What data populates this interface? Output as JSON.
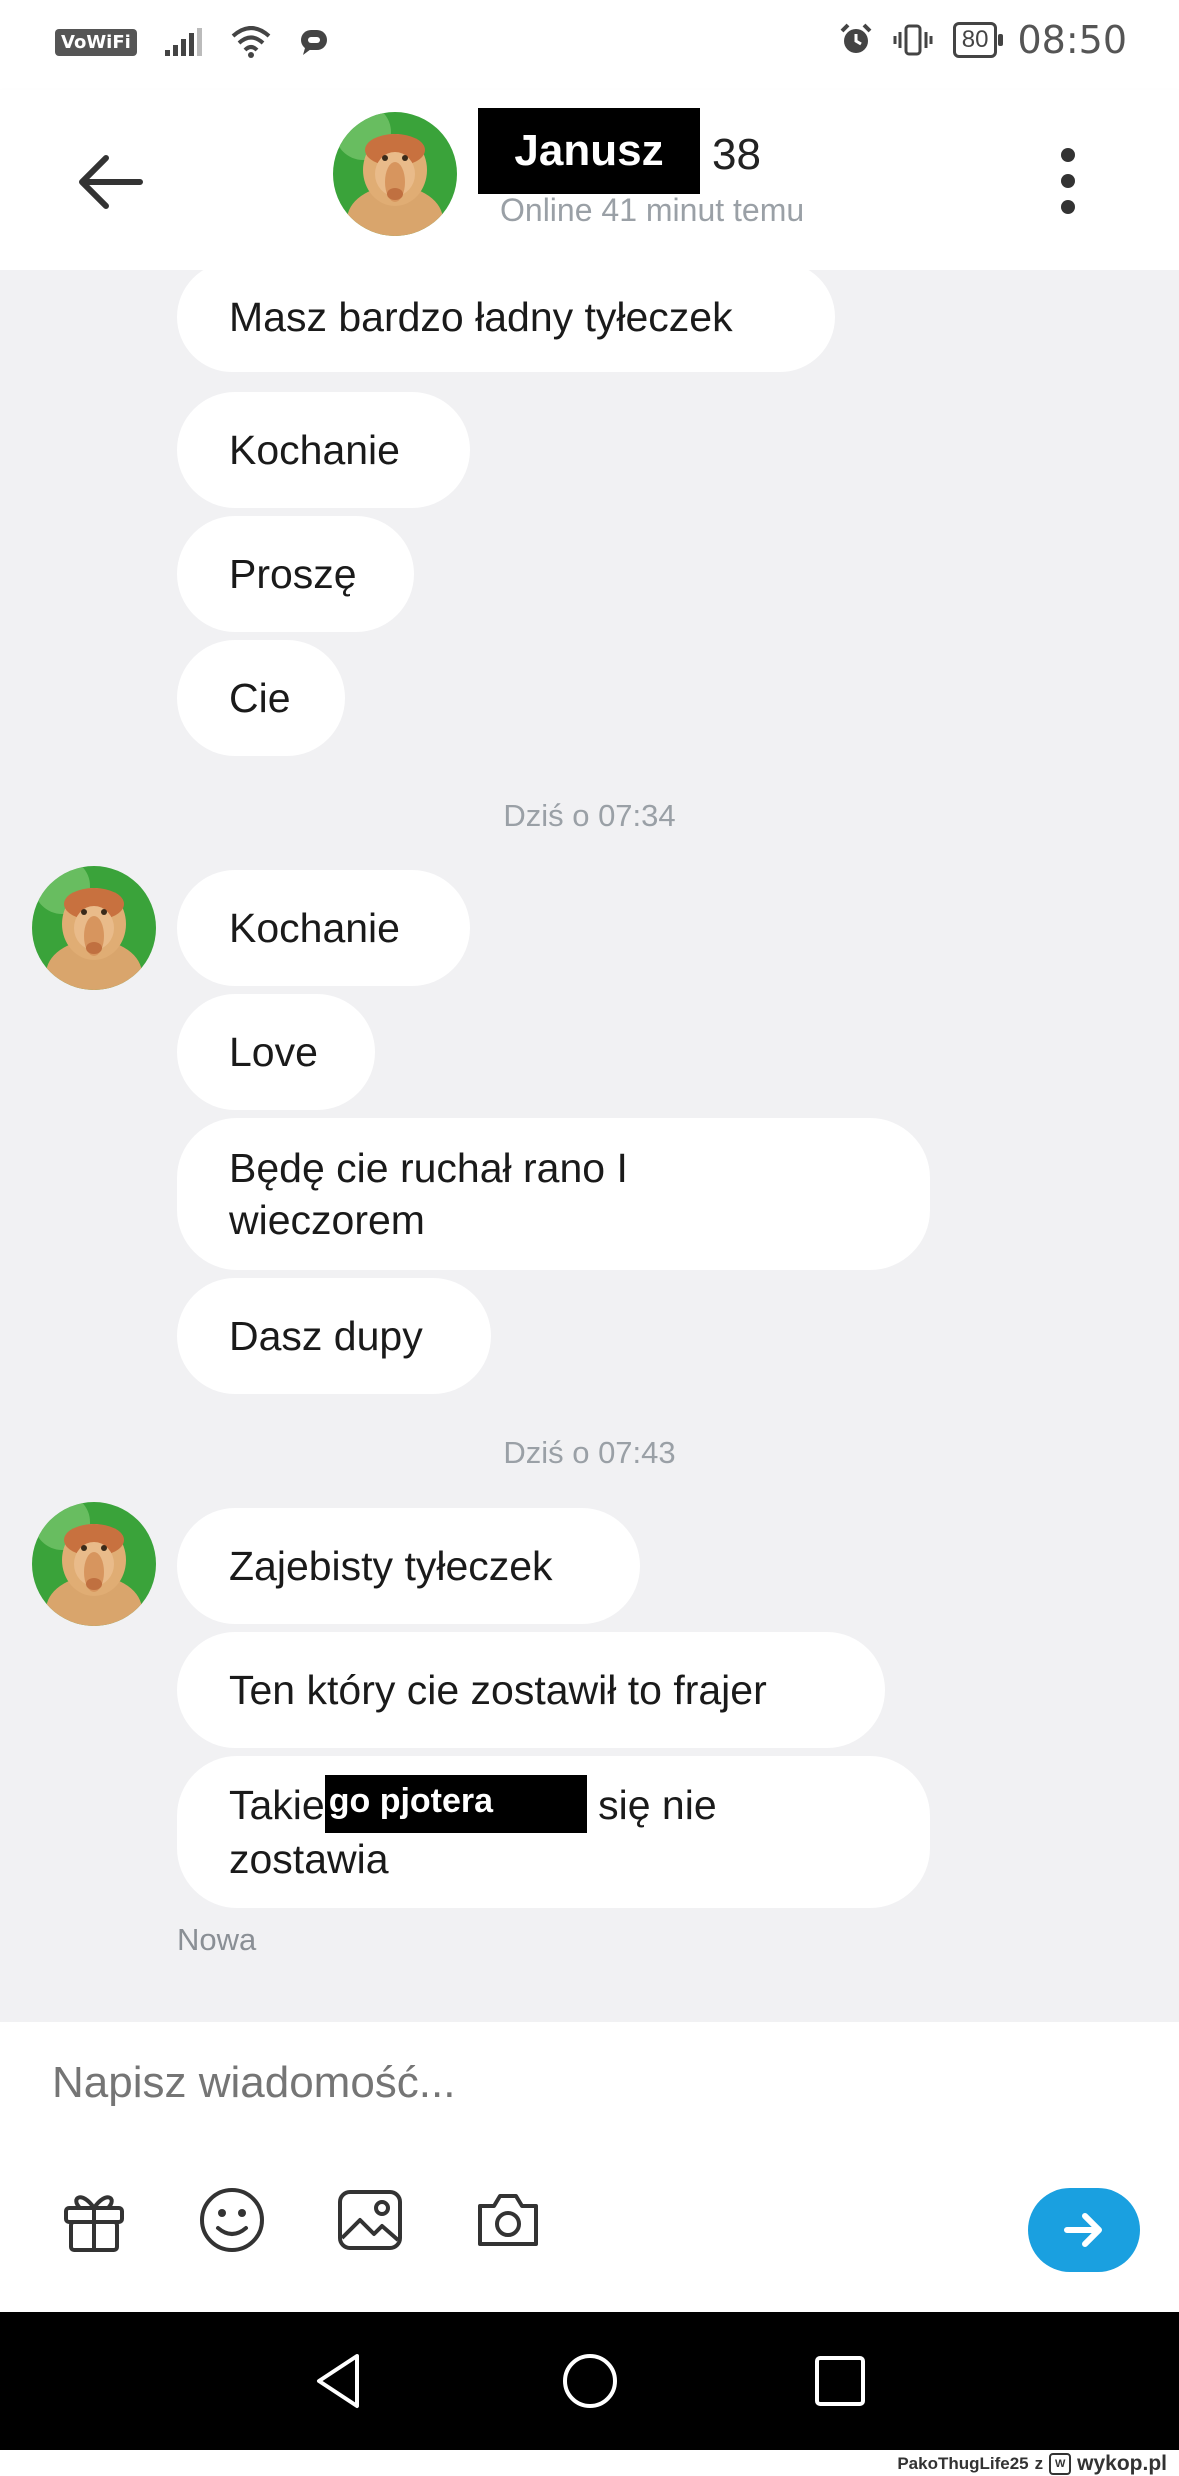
{
  "status_bar": {
    "vowifi": "VoWiFi",
    "battery": "80",
    "time": "08:50"
  },
  "header": {
    "name": "Janusz",
    "age": "38",
    "status": "Online 41 minut temu"
  },
  "messages_top": [
    "Masz bardzo ładny tyłeczek",
    "Kochanie",
    "Proszę",
    "Cie"
  ],
  "group1": {
    "timestamp": "Dziś o 07:34",
    "messages": [
      "Kochanie",
      "Love",
      "Będę cie ruchał rano I wieczorem",
      "Dasz dupy"
    ]
  },
  "group2": {
    "timestamp": "Dziś o 07:43",
    "messages": [
      "Zajebisty tyłeczek",
      "Ten który cie zostawił to frajer"
    ],
    "last_message": {
      "prefix": "Takie",
      "redacted": "go pjotera",
      "suffix": " się nie",
      "line2": "zostawia"
    },
    "label_new": "Nowa"
  },
  "composer": {
    "placeholder": "Napisz wiadomość..."
  },
  "watermark": {
    "user": "PakoThugLife25",
    "from": "z",
    "brand": "wykop.pl"
  },
  "icons": [
    "back-arrow-icon",
    "more-vertical-icon",
    "gift-icon",
    "emoji-icon",
    "gallery-icon",
    "camera-icon",
    "send-arrow-icon",
    "nav-back-icon",
    "nav-home-icon",
    "nav-recents-icon"
  ],
  "colors": {
    "accent": "#1aa0e0",
    "chat_background": "#f1f1f3",
    "bubble": "#ffffff",
    "muted_text": "#9aa0a6"
  }
}
